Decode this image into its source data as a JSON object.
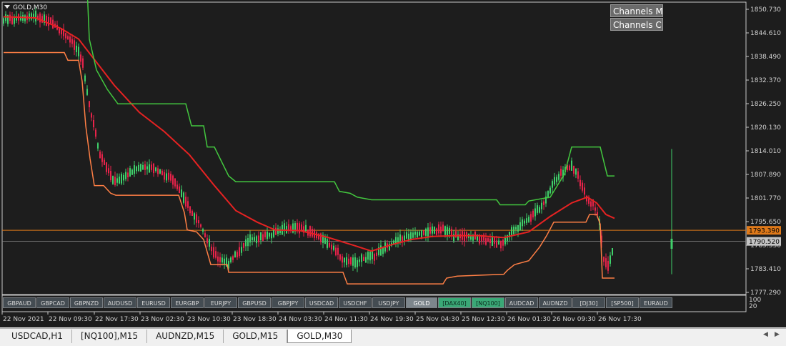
{
  "chart": {
    "symbol_label": "GOLD,M30",
    "price_axis": [
      "1850.730",
      "1844.610",
      "1838.490",
      "1832.370",
      "1826.250",
      "1820.130",
      "1814.010",
      "1807.890",
      "1801.770",
      "1795.650",
      "1789.530",
      "1783.410",
      "1777.290"
    ],
    "indicator_axis": [
      "100",
      "20"
    ],
    "time_axis": [
      "22 Nov 2021",
      "22 Nov 09:30",
      "22 Nov 17:30",
      "23 Nov 02:30",
      "23 Nov 10:30",
      "23 Nov 18:30",
      "24 Nov 03:30",
      "24 Nov 11:30",
      "24 Nov 19:30",
      "25 Nov 04:30",
      "25 Nov 12:30",
      "26 Nov 01:30",
      "26 Nov 09:30",
      "26 Nov 17:30"
    ],
    "bid_tag": "1790.520",
    "line_tag": "1793.390",
    "colors": {
      "bull": "#3fd06a",
      "bear": "#e8234a",
      "ma": "#e62222",
      "upper": "#43c83f",
      "lower": "#ff7f45",
      "hline": "#e07a1a",
      "bid": "#8a8a8a"
    }
  },
  "panel_buttons": [
    "Channels MA",
    "Channels C"
  ],
  "symbol_buttons": [
    {
      "label": "GBPAUD",
      "state": "normal"
    },
    {
      "label": "GBPCAD",
      "state": "normal"
    },
    {
      "label": "GBPNZD",
      "state": "normal"
    },
    {
      "label": "AUDUSD",
      "state": "normal"
    },
    {
      "label": "EURUSD",
      "state": "normal"
    },
    {
      "label": "EURGBP",
      "state": "normal"
    },
    {
      "label": "EURJPY",
      "state": "normal"
    },
    {
      "label": "GBPUSD",
      "state": "normal"
    },
    {
      "label": "GBPJPY",
      "state": "normal"
    },
    {
      "label": "USDCAD",
      "state": "normal"
    },
    {
      "label": "USDCHF",
      "state": "normal"
    },
    {
      "label": "USDJPY",
      "state": "normal"
    },
    {
      "label": "GOLD",
      "state": "active-grey"
    },
    {
      "label": "[DAX40]",
      "state": "active-green"
    },
    {
      "label": "[NQ100]",
      "state": "active-green"
    },
    {
      "label": "AUDCAD",
      "state": "normal"
    },
    {
      "label": "AUDNZD",
      "state": "normal"
    },
    {
      "label": "[DJ30]",
      "state": "normal"
    },
    {
      "label": "[SP500]",
      "state": "normal"
    },
    {
      "label": "EURAUD",
      "state": "normal"
    }
  ],
  "tabs": [
    {
      "label": "USDCAD,H1",
      "active": false
    },
    {
      "label": "[NQ100],M15",
      "active": false
    },
    {
      "label": "AUDNZD,M15",
      "active": false
    },
    {
      "label": "GOLD,M15",
      "active": false
    },
    {
      "label": "GOLD,M30",
      "active": true
    }
  ],
  "icons": {
    "menu": "triangle-down-icon",
    "scroll_left": "scroll-left-icon",
    "scroll_right": "scroll-right-icon"
  }
}
